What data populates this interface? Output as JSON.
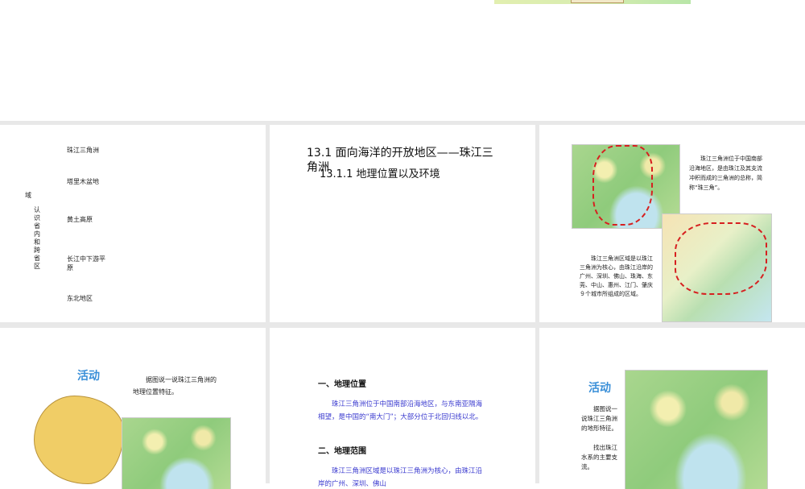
{
  "slide1": {
    "side_char": "域",
    "vertical_label": "认识省内和跨省区",
    "items": [
      "珠江三角洲",
      "塔里木盆地",
      "黄土高原",
      "长江中下游平原",
      "东北地区"
    ]
  },
  "slide2": {
    "title": "13.1  面向海洋的开放地区——珠江三角洲",
    "subtitle": "13.1.1 地理位置以及环境"
  },
  "slide3": {
    "text1": "珠江三角洲位于中国南部沿海地区，是由珠江及其支流冲积而成的三角洲的总称，简称“珠三角”。",
    "text2": "珠江三角洲区域是以珠江三角洲为核心，由珠江沿岸的广州、深圳、佛山、珠海、东莞、中山、惠州、江门、肇庆９个城市所组成的区域。"
  },
  "slide4": {
    "activity": "活动",
    "prompt": "据图说一说珠江三角洲的地理位置特征。"
  },
  "slide5": {
    "h1": "一、地理位置",
    "p1": "珠江三角洲位于中国南部沿海地区，与东南亚隔海相望，是中国的“南大门”；大部分位于北回归线以北。",
    "h2": "二、地理范围",
    "p2": "珠江三角洲区域是以珠江三角洲为核心，由珠江沿岸的广州、深圳、佛山"
  },
  "slide6": {
    "activity": "活动",
    "prompt1": "据图说一说珠江三角洲的地形特征。",
    "prompt2": "找出珠江水系的主要支流。"
  }
}
